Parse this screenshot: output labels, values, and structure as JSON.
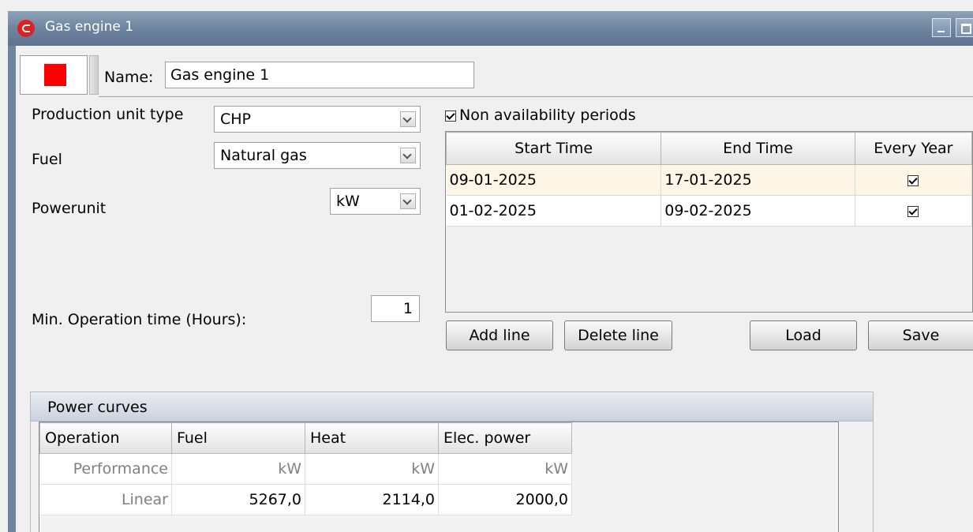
{
  "window": {
    "title": "Gas engine 1"
  },
  "name": {
    "label": "Name:",
    "value": "Gas engine 1"
  },
  "colors": {
    "unit_color": "#ff0000",
    "titlebar": "#7389a5"
  },
  "fields": {
    "production_unit_type": {
      "label": "Production unit type",
      "value": "CHP"
    },
    "fuel": {
      "label": "Fuel",
      "value": "Natural gas"
    },
    "powerunit": {
      "label": "Powerunit",
      "value": "kW"
    },
    "min_operation_time": {
      "label": "Min. Operation time (Hours):",
      "value": "1"
    }
  },
  "non_availability": {
    "label": "Non availability periods",
    "checked": true,
    "columns": [
      "Start Time",
      "End Time",
      "Every Year"
    ],
    "rows": [
      {
        "start": "09-01-2025",
        "end": "17-01-2025",
        "every_year": true
      },
      {
        "start": "01-02-2025",
        "end": "09-02-2025",
        "every_year": true
      }
    ]
  },
  "buttons": {
    "add_line": "Add line",
    "delete_line": "Delete line",
    "load": "Load",
    "save": "Save"
  },
  "power_curves": {
    "title": "Power curves",
    "columns": [
      "Operation",
      "Fuel",
      "Heat",
      "Elec. power"
    ],
    "units_row": {
      "operation": "Performance",
      "fuel": "kW",
      "heat": "kW",
      "elec": "kW"
    },
    "rows": [
      {
        "operation": "Linear",
        "fuel": "5267,0",
        "heat": "2114,0",
        "elec": "2000,0"
      }
    ]
  }
}
